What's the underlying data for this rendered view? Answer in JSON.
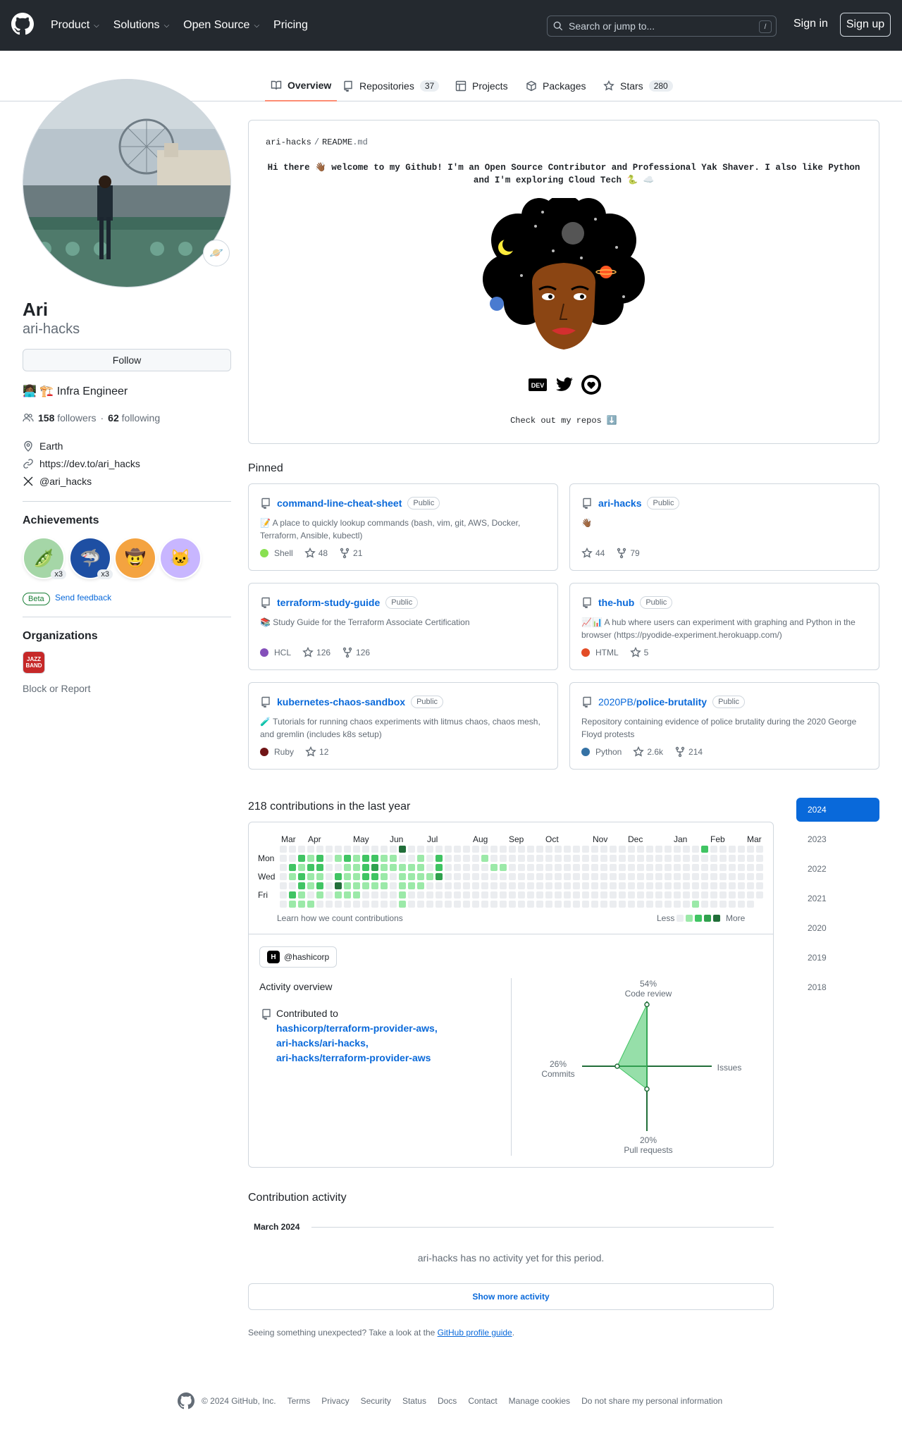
{
  "header": {
    "nav": [
      {
        "label": "Product",
        "has_menu": true
      },
      {
        "label": "Solutions",
        "has_menu": true
      },
      {
        "label": "Open Source",
        "has_menu": true
      },
      {
        "label": "Pricing",
        "has_menu": false
      }
    ],
    "search_placeholder": "Search or jump to...",
    "search_shortcut": "/",
    "sign_in": "Sign in",
    "sign_up": "Sign up"
  },
  "tabs": [
    {
      "label": "Overview",
      "icon": "book-icon",
      "active": true
    },
    {
      "label": "Repositories",
      "icon": "repo-icon",
      "count": "37"
    },
    {
      "label": "Projects",
      "icon": "table-icon"
    },
    {
      "label": "Packages",
      "icon": "package-icon"
    },
    {
      "label": "Stars",
      "icon": "star-icon",
      "count": "280"
    }
  ],
  "profile": {
    "name": "Ari",
    "login": "ari-hacks",
    "follow_label": "Follow",
    "bio": "👩🏾‍💻 🏗️ Infra Engineer",
    "followers_count": "158",
    "followers_label": "followers",
    "following_count": "62",
    "following_label": "following",
    "separator": "·",
    "location": "Earth",
    "website": "https://dev.to/ari_hacks",
    "twitter": "@ari_hacks",
    "status_emoji": "🪐"
  },
  "achievements": {
    "title": "Achievements",
    "badges": [
      {
        "name": "pair-extraordinaire",
        "emoji": "🫛",
        "count": "x3",
        "color": "#a5d6a7"
      },
      {
        "name": "pull-shark",
        "emoji": "🦈",
        "count": "x3",
        "color": "#1e4fa3"
      },
      {
        "name": "starstruck",
        "emoji": "🤠",
        "count": "",
        "color": "#f4a340"
      },
      {
        "name": "quickdraw",
        "emoji": "🐱",
        "count": "",
        "color": "#c8b6ff"
      }
    ],
    "beta": "Beta",
    "feedback": "Send feedback"
  },
  "organizations": {
    "title": "Organizations",
    "org_logo_text": "JAZZ BAND",
    "block": "Block or Report"
  },
  "readme": {
    "owner": "ari-hacks",
    "separator": "/",
    "file": "README",
    "ext": ".md",
    "intro": "Hi there 👋🏾 welcome to my Github! I'm an Open Source Contributor and Professional Yak Shaver. I also like Python and I'm exploring Cloud Tech 🐍 ☁️",
    "footer": "Check out my repos ⬇️",
    "social_icons": [
      "dev-icon",
      "twitter-icon",
      "heart-icon"
    ],
    "dev_text": "DEV"
  },
  "pinned": {
    "title": "Pinned",
    "repos": [
      {
        "owner": "",
        "name": "command-line-cheat-sheet",
        "visibility": "Public",
        "desc": "📝 A place to quickly lookup commands (bash, vim, git, AWS, Docker, Terraform, Ansible, kubectl)",
        "lang": "Shell",
        "lang_color": "#89e051",
        "stars": "48",
        "forks": "21"
      },
      {
        "owner": "",
        "name": "ari-hacks",
        "visibility": "Public",
        "desc": "👋🏾",
        "lang": "",
        "lang_color": "",
        "stars": "44",
        "forks": "79"
      },
      {
        "owner": "",
        "name": "terraform-study-guide",
        "visibility": "Public",
        "desc": "📚 Study Guide for the Terraform Associate Certification",
        "lang": "HCL",
        "lang_color": "#844fba",
        "stars": "126",
        "forks": "126"
      },
      {
        "owner": "",
        "name": "the-hub",
        "visibility": "Public",
        "desc": "📈📊 A hub where users can experiment with graphing and Python in the browser (https://pyodide-experiment.herokuapp.com/)",
        "lang": "HTML",
        "lang_color": "#e34c26",
        "stars": "5",
        "forks": ""
      },
      {
        "owner": "",
        "name": "kubernetes-chaos-sandbox",
        "visibility": "Public",
        "desc": "🧪 Tutorials for running chaos experiments with litmus chaos, chaos mesh, and gremlin (includes k8s setup)",
        "lang": "Ruby",
        "lang_color": "#701516",
        "stars": "12",
        "forks": ""
      },
      {
        "owner": "2020PB/",
        "name": "police-brutality",
        "visibility": "Public",
        "desc": "Repository containing evidence of police brutality during the 2020 George Floyd protests",
        "lang": "Python",
        "lang_color": "#3572a5",
        "stars": "2.6k",
        "forks": "214"
      }
    ]
  },
  "contributions": {
    "title": "218 contributions in the last year",
    "months": [
      "Mar",
      "Apr",
      "May",
      "Jun",
      "Jul",
      "Aug",
      "Sep",
      "Oct",
      "Nov",
      "Dec",
      "Jan",
      "Feb",
      "Mar"
    ],
    "days": [
      "Mon",
      "Wed",
      "Fri"
    ],
    "learn": "Learn how we count contributions",
    "less": "Less",
    "more": "More",
    "levels": [
      "#ebedf0",
      "#9be9a8",
      "#40c463",
      "#30a14e",
      "#216e39"
    ],
    "years": [
      "2024",
      "2023",
      "2022",
      "2021",
      "2020",
      "2019",
      "2018"
    ],
    "active_year": "2024"
  },
  "activity": {
    "org": "@hashicorp",
    "org_logo": "H",
    "title": "Activity overview",
    "contributed_to": "Contributed to",
    "repos": [
      "hashicorp/terraform-provider-aws,",
      "ari-hacks/ari-hacks,",
      "ari-hacks/terraform-provider-aws"
    ],
    "radar": {
      "code_review_pct": "54%",
      "code_review": "Code review",
      "commits_pct": "26%",
      "commits": "Commits",
      "issues": "Issues",
      "pull_requests_pct": "20%",
      "pull_requests": "Pull requests",
      "values": {
        "code_review": 54,
        "commits": 26,
        "issues": 0,
        "pull_requests": 20
      }
    }
  },
  "contribution_activity": {
    "title": "Contribution activity",
    "month": "March 2024",
    "none": "ari-hacks has no activity yet for this period.",
    "show_more": "Show more activity",
    "unexpected_prefix": "Seeing something unexpected? Take a look at the",
    "guide_link": "GitHub profile guide",
    "unexpected_suffix": "."
  },
  "footer": {
    "copyright": "© 2024 GitHub, Inc.",
    "links": [
      "Terms",
      "Privacy",
      "Security",
      "Status",
      "Docs",
      "Contact",
      "Manage cookies",
      "Do not share my personal information"
    ]
  }
}
